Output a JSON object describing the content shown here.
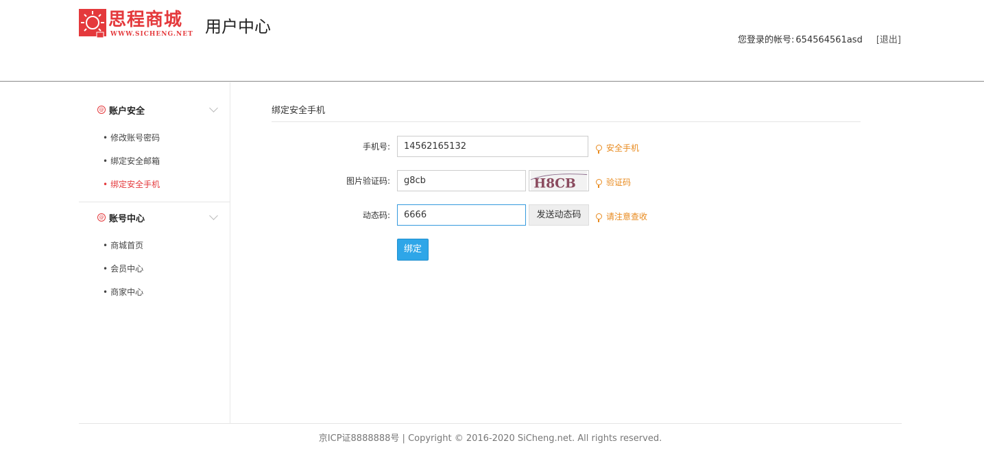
{
  "header": {
    "logo_text": "思程商城",
    "logo_url": "WWW.SICHENG.NET",
    "page_title": "用户中心",
    "account_label": "您登录的帐号:",
    "account_value": "654564561asd",
    "logout_label": "[退出]"
  },
  "sidebar": {
    "groups": [
      {
        "title": "账户安全",
        "items": [
          "修改账号密码",
          "绑定安全邮箱",
          "绑定安全手机"
        ],
        "active_item": "绑定安全手机"
      },
      {
        "title": "账号中心",
        "items": [
          "商城首页",
          "会员中心",
          "商家中心"
        ]
      }
    ]
  },
  "main": {
    "section_title": "绑定安全手机",
    "phone": {
      "label": "手机号:",
      "value": "14562165132",
      "hint": "安全手机"
    },
    "captcha": {
      "label": "图片验证码:",
      "value": "g8cb",
      "image_text": "H8CB",
      "hint": "验证码"
    },
    "sms": {
      "label": "动态码:",
      "value": "6666",
      "send_label": "发送动态码",
      "hint": "请注意查收"
    },
    "submit_label": "绑定"
  },
  "footer": {
    "text": "京ICP证8888888号 | Copyright © 2016-2020 SiCheng.net. All rights reserved."
  },
  "colors": {
    "brand": "#e4393c",
    "primary": "#2ea6e8",
    "hint": "#e88a1e"
  }
}
